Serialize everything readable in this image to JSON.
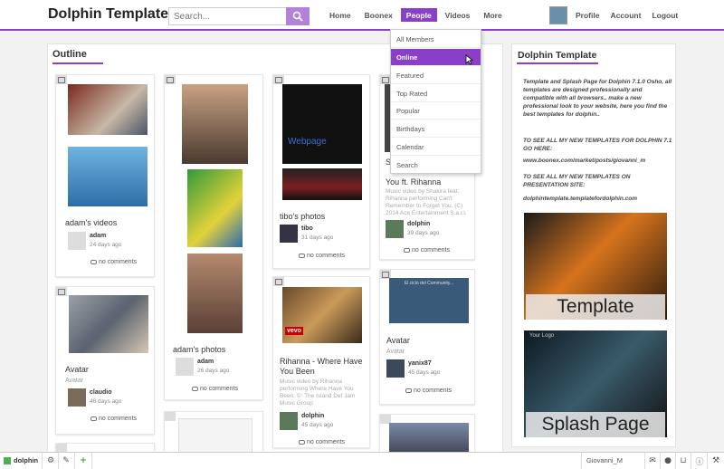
{
  "header": {
    "logo": "Dolphin Template",
    "search_placeholder": "Search...",
    "nav": [
      "Home",
      "Boonex",
      "People",
      "Videos",
      "More"
    ],
    "active_nav": "People",
    "right_nav": [
      "Profile",
      "Account",
      "Logout"
    ]
  },
  "people_menu": [
    "All Members",
    "Online",
    "Featured",
    "Top Rated",
    "Popular",
    "Birthdays",
    "Calendar",
    "Search"
  ],
  "people_menu_active": "Online",
  "outline": {
    "title": "Outline",
    "cards": {
      "adam_videos": {
        "title": "adam's videos",
        "user": "adam",
        "date": "24 days ago",
        "comments": "no comments"
      },
      "adam_photos": {
        "title": "adam's photos",
        "user": "adam",
        "date": "26 days ago",
        "comments": "no comments"
      },
      "tibo_photos": {
        "title": "tibo's photos",
        "user": "tibo",
        "date": "31 days ago",
        "comments": "no comments",
        "image_text": "Webpage"
      },
      "shakira": {
        "title_top": "S",
        "title_line": "You ft. Rihanna",
        "desc": "Music video by Shakira feat. Rihanna performing Can't Remember to Forget You. (C) 2014 Ace Entertainment S.a.r.l.",
        "user": "dolphin",
        "date": "39 days ago",
        "comments": "no comments"
      },
      "avatar_claudio": {
        "title": "Avatar",
        "sub": "Avatar",
        "user": "claudio",
        "date": "46 days ago",
        "comments": "no comments"
      },
      "rihanna": {
        "title": "Rihanna - Where Have You Been",
        "desc": "Music video by Rihanna performing Where Have You Been. ©: The Island Def Jam Music Group",
        "user": "dolphin",
        "date": "45 days ago",
        "comments": "no comments",
        "image_text": "vevo"
      },
      "avatar_yanix": {
        "title": "Avatar",
        "sub": "Avatar",
        "user": "yanix87",
        "date": "45 days ago",
        "comments": "no comments",
        "image_text": "El ciclo del Community..."
      }
    }
  },
  "right": {
    "title": "Dolphin Template",
    "p1": "Template and Splash Page for Dolphin 7.1.0 Osho, all templates are designed professionally and compatible with all browsers.. make a new professional look to your website, here you find the best templates for dolphin..",
    "p2": "TO SEE ALL MY NEW TEMPLATES FOR DOLPHIN 7.1 GO HERE:",
    "p3": "www.boonex.com/market/posts/giovanni_m",
    "p4": "TO SEE ALL MY NEW TEMPLATES ON PRESENTATION SITE:",
    "p5": "dolphintemplate.templatefordolphin.com",
    "promo1": "Template",
    "promo2": "Splash Page",
    "promo2_logo": "Your Logo"
  },
  "bottombar": {
    "brand": "dolphin",
    "user": "Giovanni_M"
  },
  "colors": {
    "accent": "#8a3fc8"
  },
  "icons": {
    "search": "search-icon",
    "cursor": "cursor-icon",
    "settings": "gear-icon",
    "edit": "edit-icon",
    "add": "plus-icon",
    "mail": "mail-icon",
    "user": "user-icon",
    "cart": "cart-icon",
    "info": "info-icon",
    "tools": "wrench-icon"
  }
}
